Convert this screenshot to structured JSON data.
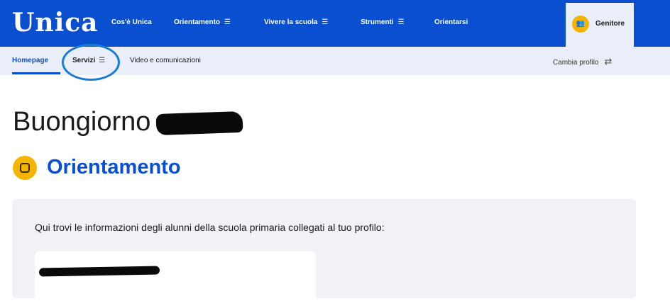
{
  "header": {
    "logo": "Unica",
    "nav": [
      {
        "label": "Cos'è Unica",
        "has_menu": false
      },
      {
        "label": "Orientamento",
        "has_menu": true
      },
      {
        "label": "Vivere la scuola",
        "has_menu": true
      },
      {
        "label": "Strumenti",
        "has_menu": true
      },
      {
        "label": "Orientarsi",
        "has_menu": false
      }
    ],
    "menu_icon": "☰",
    "profile": {
      "avatar_icon": "parent-avatar-icon",
      "avatar_glyph": "👥",
      "label": "Genitore"
    }
  },
  "subnav": {
    "items": [
      {
        "label": "Homepage",
        "active": true
      },
      {
        "label": "Servizi",
        "has_menu": true
      },
      {
        "label": "Video e comunicazioni"
      }
    ],
    "switch_profile_label": "Cambia profilo",
    "switch_icon_glyph": "⇄"
  },
  "main": {
    "greeting": "Buongiorno",
    "section_title": "Orientamento",
    "info_text": "Qui trovi le informazioni degli alunni della scuola primaria collegati al tuo profilo:"
  },
  "colors": {
    "brand_blue": "#0b4fd1",
    "accent_yellow": "#f4b400",
    "subnav_bg": "#e9eef8",
    "card_bg": "#f0f2f5",
    "annotation_circle": "#1a7ad9"
  }
}
